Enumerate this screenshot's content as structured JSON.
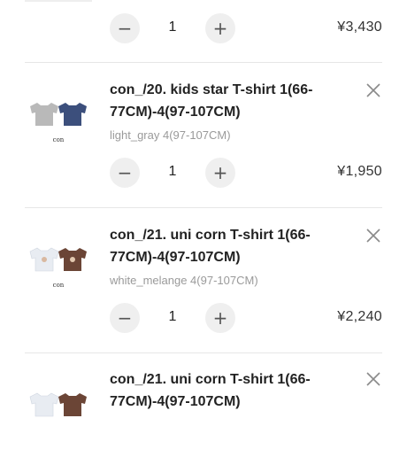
{
  "colors": {
    "accent": "#f0f0f0",
    "divider": "#e6e6e6",
    "variant": "#9a9a9a"
  },
  "icons": {
    "minus": "minus-icon",
    "plus": "plus-icon",
    "remove": "close-icon"
  },
  "top_item": {
    "quantity": "1",
    "price": "¥3,430"
  },
  "items": [
    {
      "title": "con_/20. kids star T-shirt 1(66-77CM)-4(97-107CM)",
      "variant": "light_gray 4(97-107CM)",
      "quantity": "1",
      "price": "¥1,950",
      "thumb_label": "con"
    },
    {
      "title": "con_/21. uni corn T-shirt 1(66-77CM)-4(97-107CM)",
      "variant": "white_melange 4(97-107CM)",
      "quantity": "1",
      "price": "¥2,240",
      "thumb_label": "con"
    },
    {
      "title": "con_/21. uni corn T-shirt 1(66-77CM)-4(97-107CM)"
    }
  ]
}
